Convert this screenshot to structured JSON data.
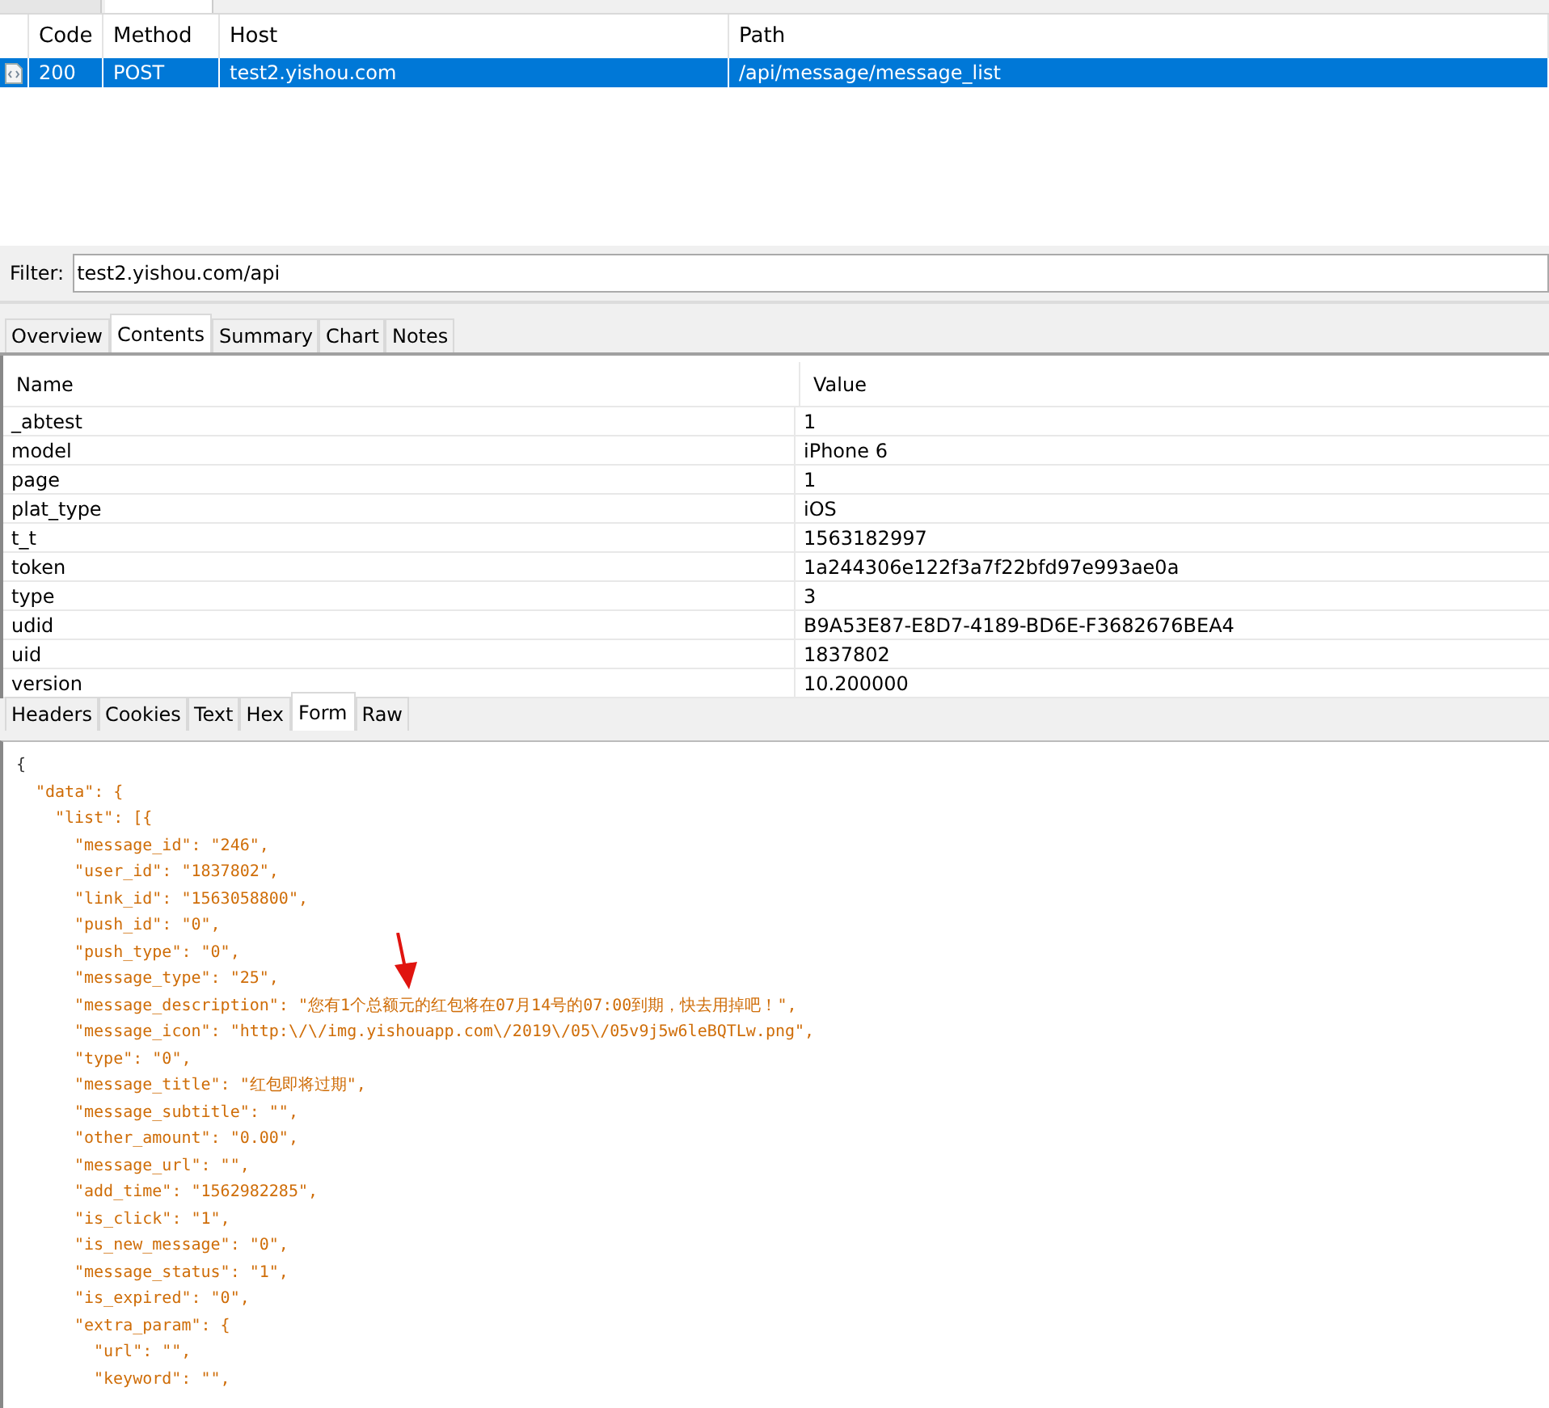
{
  "top_tabs": [
    {
      "selected": false
    },
    {
      "selected": true
    }
  ],
  "sessions": {
    "columns": [
      "Code",
      "Method",
      "Host",
      "Path"
    ],
    "rows": [
      {
        "selected": true,
        "cells": [
          "200",
          "POST",
          "test2.yishou.com",
          "/api/message/message_list"
        ]
      }
    ]
  },
  "filter": {
    "label": "Filter:",
    "value": "test2.yishou.com/api"
  },
  "detail_tabs": [
    {
      "label": "Overview",
      "selected": false
    },
    {
      "label": "Contents",
      "selected": true
    },
    {
      "label": "Summary",
      "selected": false
    },
    {
      "label": "Chart",
      "selected": false
    },
    {
      "label": "Notes",
      "selected": false
    }
  ],
  "params": {
    "columns": [
      "Name",
      "Value"
    ],
    "rows": [
      [
        "_abtest",
        "1"
      ],
      [
        "model",
        "iPhone 6"
      ],
      [
        "page",
        "1"
      ],
      [
        "plat_type",
        "iOS"
      ],
      [
        "t_t",
        "1563182997"
      ],
      [
        "token",
        "1a244306e122f3a7f22bfd97e993ae0a"
      ],
      [
        "type",
        "3"
      ],
      [
        "udid",
        "B9A53E87-E8D7-4189-BD6E-F3682676BEA4"
      ],
      [
        "uid",
        "1837802"
      ],
      [
        "version",
        "10.200000"
      ]
    ]
  },
  "body_tabs": [
    {
      "label": "Headers",
      "selected": false
    },
    {
      "label": "Cookies",
      "selected": false
    },
    {
      "label": "Text",
      "selected": false
    },
    {
      "label": "Hex",
      "selected": false
    },
    {
      "label": "Form",
      "selected": true
    },
    {
      "label": "Raw",
      "selected": false
    }
  ],
  "body": [
    {
      "text": "{",
      "kind": "brace",
      "children": [
        {
          "text": "\"data\": {",
          "kind": "entry",
          "children": [
            {
              "text": "\"list\": [{",
              "kind": "entry",
              "children": [
                {
                  "text": "\"message_id\": \"246\",",
                  "kind": "entry"
                },
                {
                  "text": "\"user_id\": \"1837802\",",
                  "kind": "entry"
                },
                {
                  "text": "\"link_id\": \"1563058800\",",
                  "kind": "entry"
                },
                {
                  "text": "\"push_id\": \"0\",",
                  "kind": "entry"
                },
                {
                  "text": "\"push_type\": \"0\",",
                  "kind": "entry"
                },
                {
                  "text": "\"message_type\": \"25\",",
                  "kind": "entry"
                },
                {
                  "text": "\"message_description\": \"您有1个总额元的红包将在07月14号的07:00到期，快去用掉吧！\",",
                  "kind": "entry",
                  "annotated": true
                },
                {
                  "text": "\"message_icon\": \"http:\\/\\/img.yishouapp.com\\/2019\\/05\\/05v9j5w6leBQTLw.png\",",
                  "kind": "entry"
                },
                {
                  "text": "\"type\": \"0\",",
                  "kind": "entry"
                },
                {
                  "text": "\"message_title\": \"红包即将过期\",",
                  "kind": "entry"
                },
                {
                  "text": "\"message_subtitle\": \"\",",
                  "kind": "entry"
                },
                {
                  "text": "\"other_amount\": \"0.00\",",
                  "kind": "entry"
                },
                {
                  "text": "\"message_url\": \"\",",
                  "kind": "entry"
                },
                {
                  "text": "\"add_time\": \"1562982285\",",
                  "kind": "entry"
                },
                {
                  "text": "\"is_click\": \"1\",",
                  "kind": "entry"
                },
                {
                  "text": "\"is_new_message\": \"0\",",
                  "kind": "entry"
                },
                {
                  "text": "\"message_status\": \"1\",",
                  "kind": "entry"
                },
                {
                  "text": "\"is_expired\": \"0\",",
                  "kind": "entry"
                },
                {
                  "text": "\"extra_param\": {",
                  "kind": "entry",
                  "children": [
                    {
                      "text": "\"url\": \"\",",
                      "kind": "entry"
                    },
                    {
                      "text": "\"keyword\": \"\",",
                      "kind": "entry"
                    }
                  ]
                }
              ]
            }
          ]
        }
      ]
    }
  ]
}
